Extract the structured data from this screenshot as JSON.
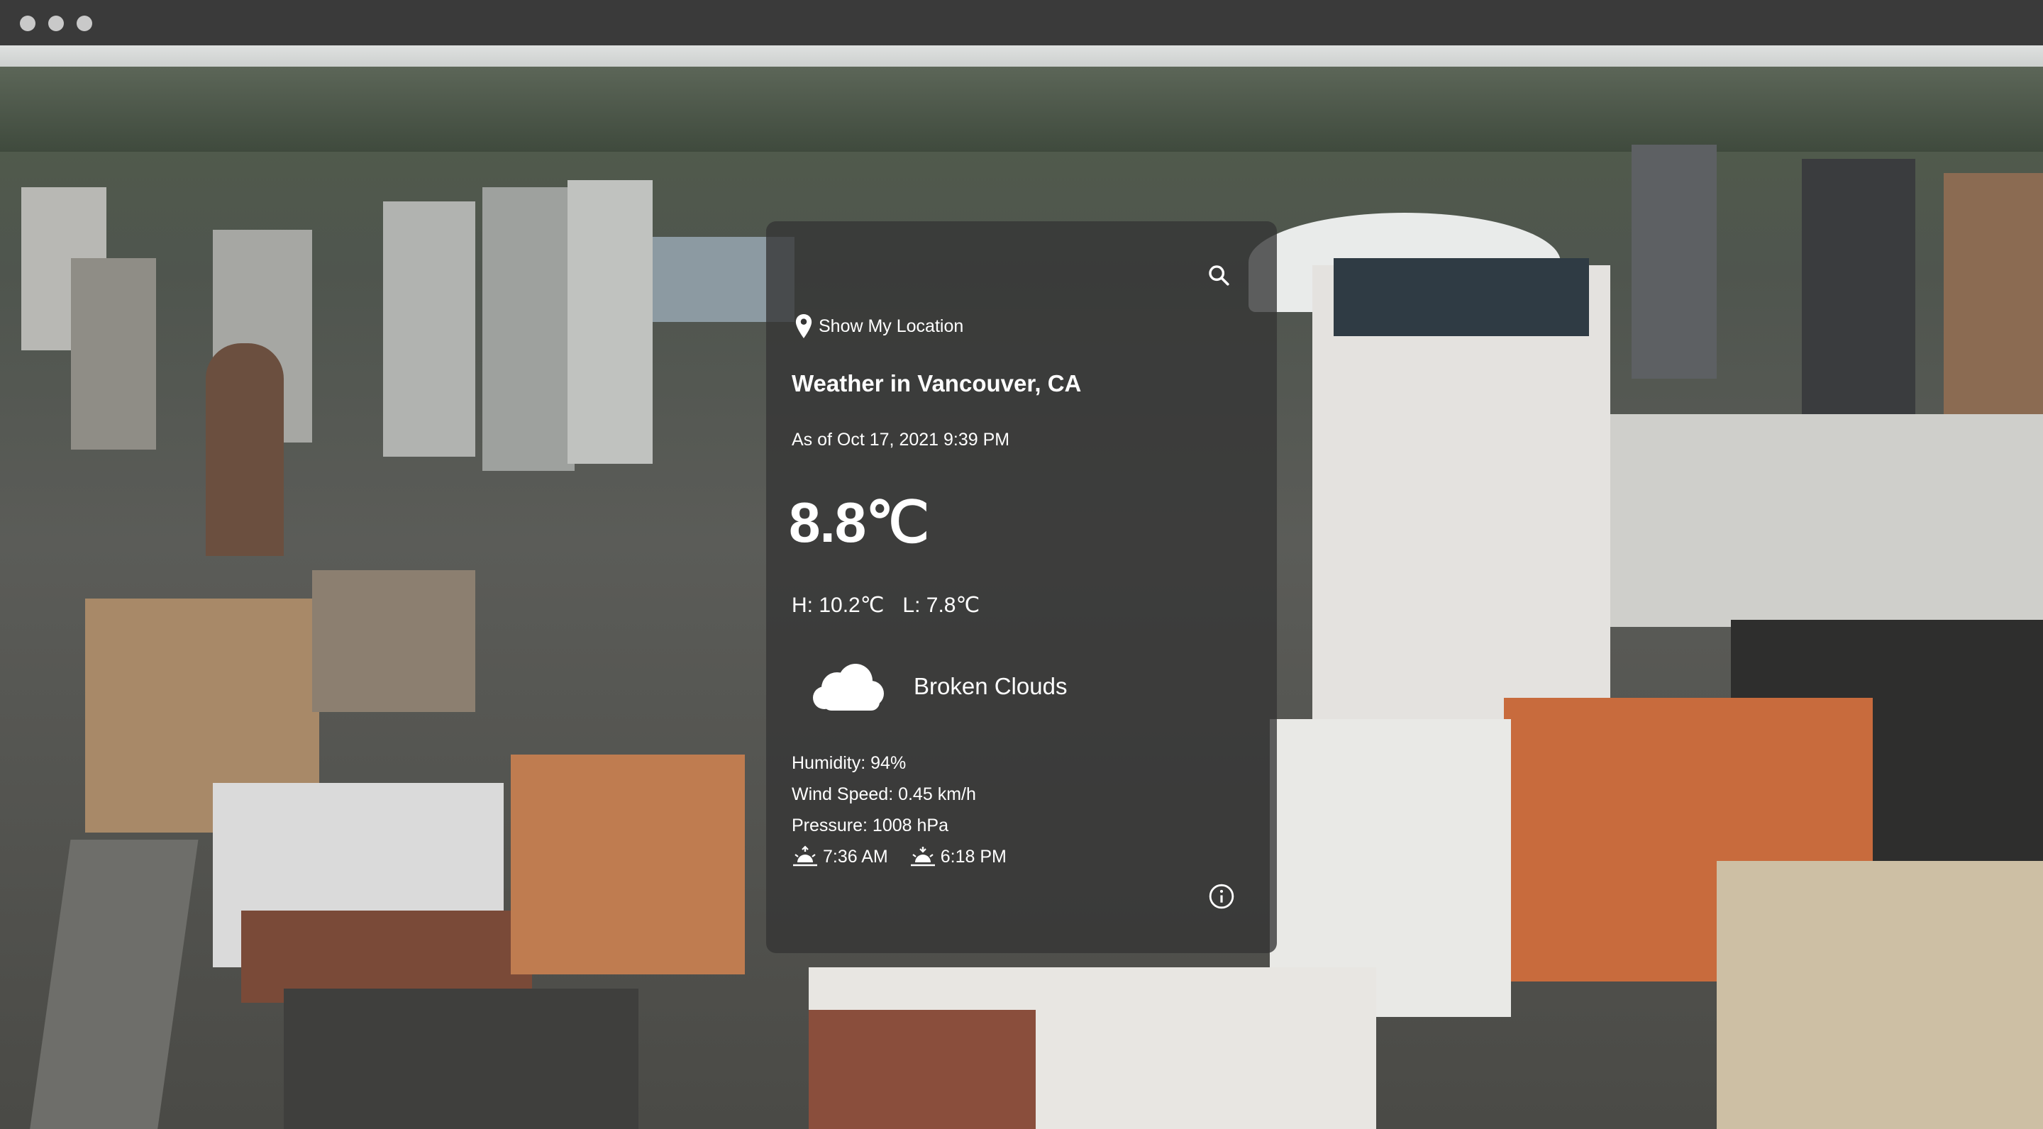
{
  "window": {
    "controls": [
      "close",
      "minimize",
      "maximize"
    ]
  },
  "card": {
    "search_icon": "search-icon",
    "show_location_label": "Show My Location",
    "location_icon": "map-pin-icon",
    "city_heading": "Weather in Vancouver, CA",
    "as_of": "As of Oct 17, 2021 9:39 PM",
    "temperature": "8.8℃",
    "high": "H: 10.2℃",
    "low": "L: 7.8℃",
    "condition_icon": "cloud-icon",
    "condition": "Broken Clouds",
    "humidity": "Humidity: 94%",
    "wind_speed": "Wind Speed: 0.45 km/h",
    "pressure": "Pressure: 1008 hPa",
    "sunrise_icon": "sunrise-icon",
    "sunrise": "7:36 AM",
    "sunset_icon": "sunset-icon",
    "sunset": "6:18 PM",
    "info_icon": "info-icon"
  },
  "colors": {
    "card_background": "#343434",
    "text": "#ffffff",
    "window_bar": "#3a3a3a"
  }
}
